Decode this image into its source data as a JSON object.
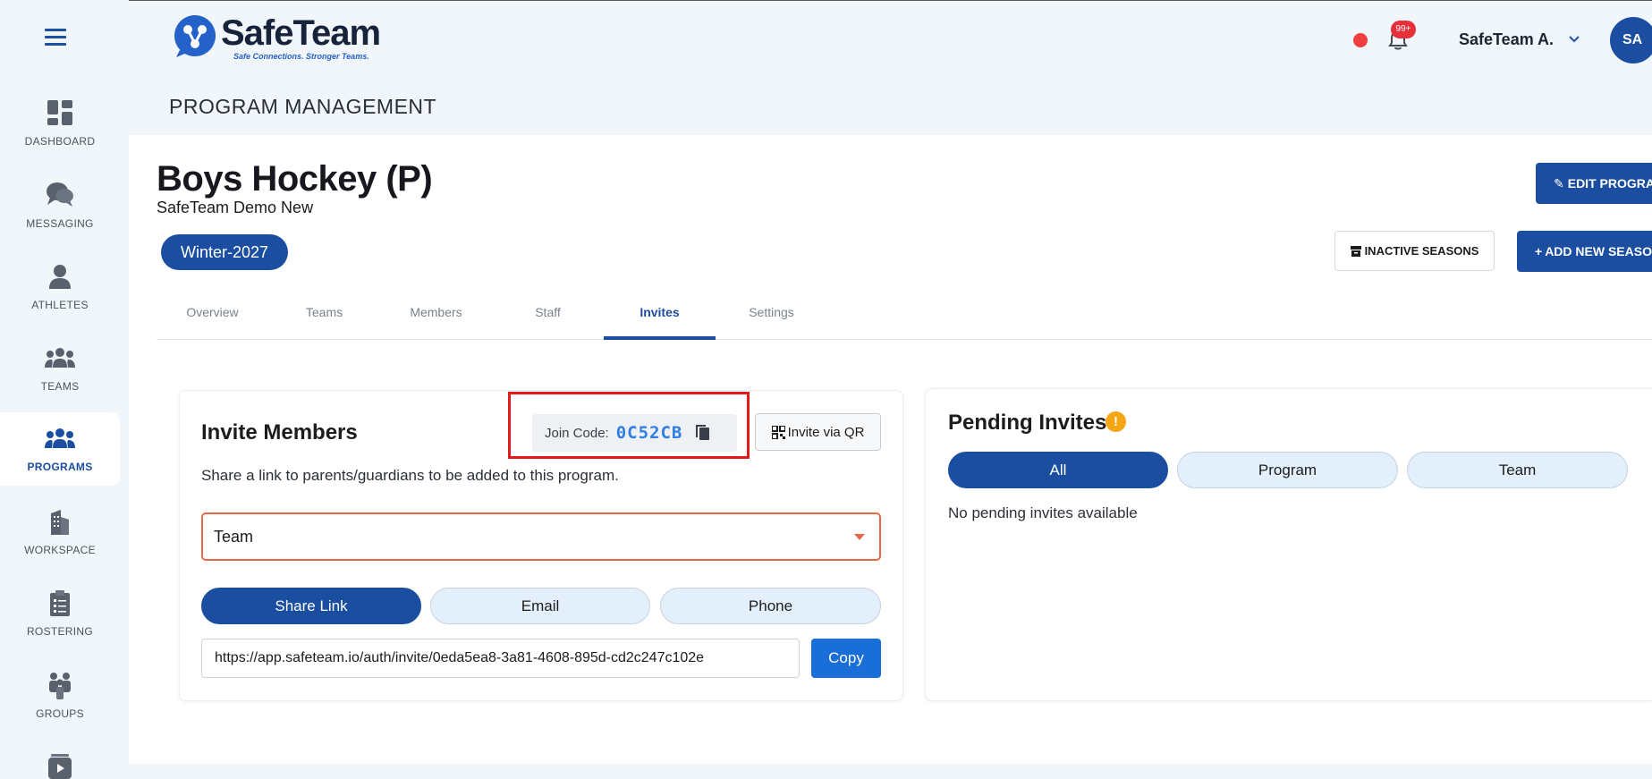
{
  "app": {
    "brand": "SafeTeam",
    "tagline": "Safe Connections. Stronger Teams.",
    "page_heading": "PROGRAM MANAGEMENT"
  },
  "header": {
    "notification_count": "99+",
    "user_name": "SafeTeam A.",
    "avatar_initials": "SA"
  },
  "sidebar": {
    "items": [
      {
        "label": "DASHBOARD",
        "icon": "dashboard-icon"
      },
      {
        "label": "MESSAGING",
        "icon": "messaging-icon"
      },
      {
        "label": "ATHLETES",
        "icon": "athlete-icon"
      },
      {
        "label": "TEAMS",
        "icon": "teams-icon"
      },
      {
        "label": "PROGRAMS",
        "icon": "programs-icon",
        "active": true
      },
      {
        "label": "WORKSPACE",
        "icon": "workspace-icon"
      },
      {
        "label": "ROSTERING",
        "icon": "rostering-icon"
      },
      {
        "label": "GROUPS",
        "icon": "groups-icon"
      },
      {
        "label": "",
        "icon": "video-icon"
      }
    ]
  },
  "program": {
    "title": "Boys Hockey (P)",
    "subtitle": "SafeTeam Demo New",
    "season": "Winter-2027",
    "edit_label": "EDIT PROGRAM",
    "inactive_seasons_label": "INACTIVE SEASONS",
    "add_season_label": "ADD NEW SEASON"
  },
  "tabs": [
    "Overview",
    "Teams",
    "Members",
    "Staff",
    "Invites",
    "Settings"
  ],
  "active_tab": "Invites",
  "invite": {
    "title": "Invite Members",
    "join_code_label": "Join Code:",
    "join_code": "0C52CB",
    "qr_label": "Invite via QR",
    "description": "Share a link to parents/guardians to be added to this program.",
    "select_value": "Team",
    "methods": [
      "Share Link",
      "Email",
      "Phone"
    ],
    "active_method": "Share Link",
    "link": "https://app.safeteam.io/auth/invite/0eda5ea8-3a81-4608-895d-cd2c247c102e",
    "copy_label": "Copy"
  },
  "pending": {
    "title": "Pending Invites",
    "filters": [
      "All",
      "Program",
      "Team"
    ],
    "active_filter": "All",
    "empty_text": "No pending invites available"
  },
  "colors": {
    "primary": "#1b4ea0",
    "accent": "#1a6ed8",
    "background": "#f1f6fb",
    "highlight_frame": "#e21a1a",
    "warning": "#f4a614"
  }
}
